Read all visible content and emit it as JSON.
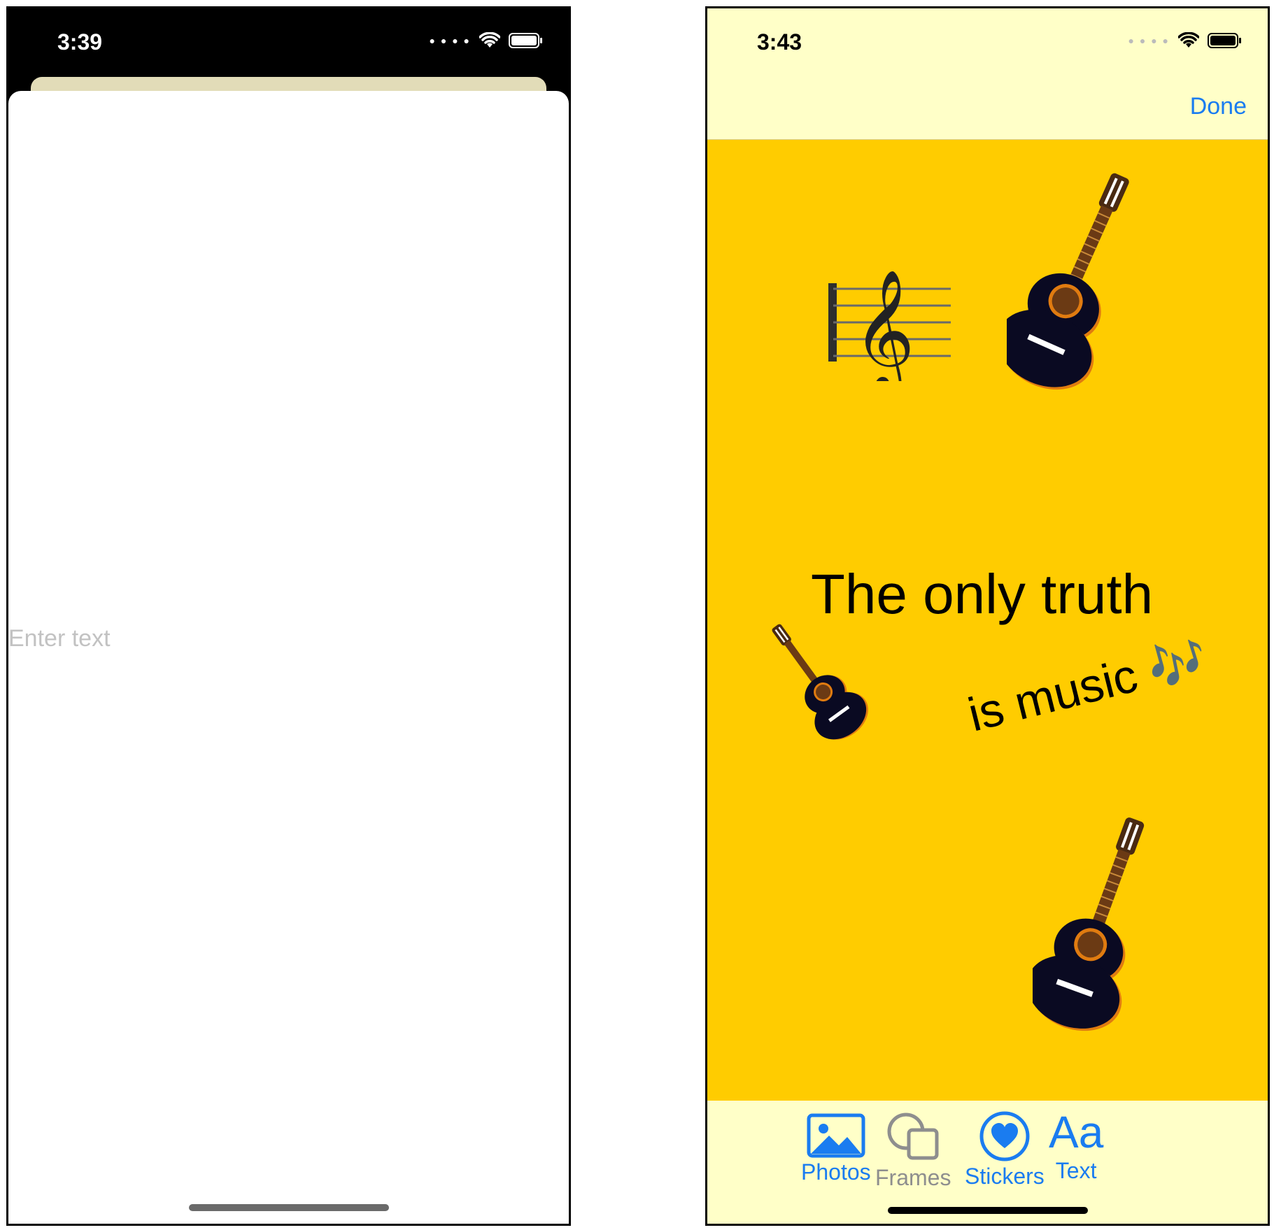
{
  "left_screen": {
    "status": {
      "time": "3:39"
    },
    "text_field": {
      "placeholder": "Enter text",
      "value": ""
    }
  },
  "right_screen": {
    "status": {
      "time": "3:43"
    },
    "nav": {
      "done_label": "Done"
    },
    "canvas": {
      "background_color": "#ffcc00",
      "quote_line1": "The only truth",
      "quote_line2": "is music",
      "quote_emoji": "🎶",
      "stickers": [
        "treble-clef-staff",
        "guitar",
        "guitar",
        "guitar"
      ]
    },
    "toolbar": {
      "items": [
        {
          "label": "Photos",
          "icon": "photo-icon",
          "state": "active"
        },
        {
          "label": "Frames",
          "icon": "frames-icon",
          "state": "inactive"
        },
        {
          "label": "Stickers",
          "icon": "heart-circle-icon",
          "state": "active"
        },
        {
          "label": "Text",
          "icon": "text-aa-icon",
          "state": "active"
        }
      ]
    }
  },
  "colors": {
    "accent": "#1a7cf0",
    "inactive": "#8e8e8e",
    "bar_background": "#ffffc8"
  }
}
